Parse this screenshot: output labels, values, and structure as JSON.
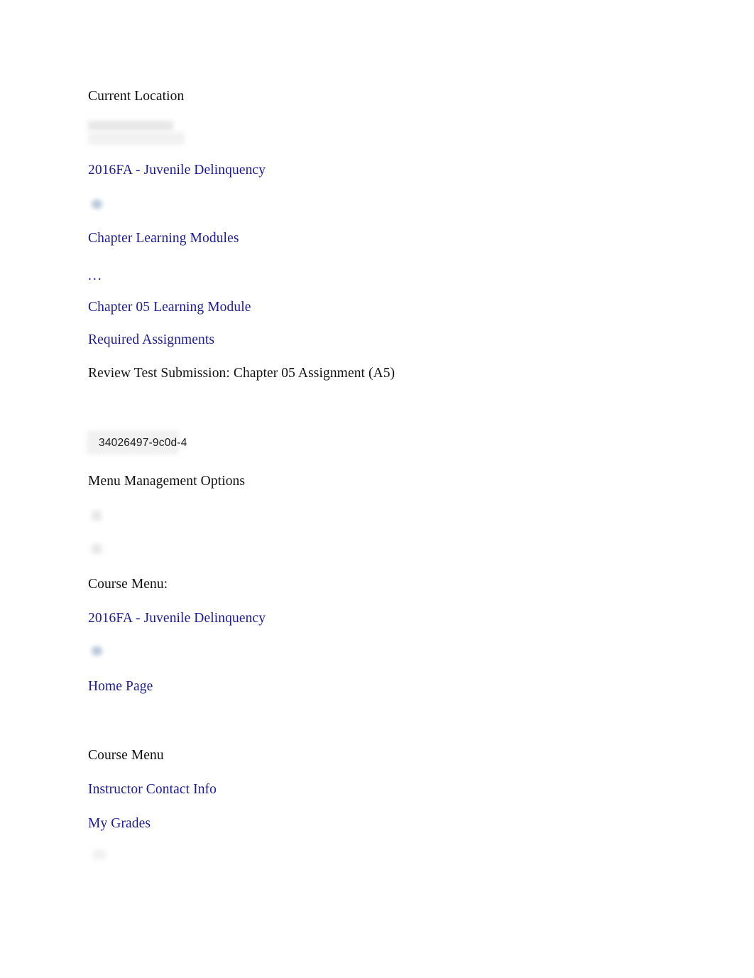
{
  "document": {
    "background_color": "#ffffff",
    "text_color": "#111111",
    "link_color": "#1c1c8f"
  },
  "breadcrumb": {
    "heading": "Current Location",
    "separator": "...",
    "items": [
      {
        "label": "2016FA - Juvenile Delinquency",
        "type": "link"
      },
      {
        "label": "Chapter Learning Modules",
        "type": "link"
      },
      {
        "label": "Chapter 05 Learning Module",
        "type": "link"
      },
      {
        "label": "Required Assignments",
        "type": "link"
      },
      {
        "label": "Review Test Submission: Chapter 05 Assignment (A5)",
        "type": "text"
      }
    ],
    "icons": [
      "institution-logo-placeholder",
      "breadcrumb-separator-icon",
      "breadcrumb-ellipsis-icon"
    ]
  },
  "session": {
    "id_label": "34026497-9c0d-4"
  },
  "menu_management": {
    "heading": "Menu Management Options",
    "icons": [
      "refresh-icon",
      "expand-icon"
    ],
    "course_menu_label": "Course Menu:",
    "course_link": "2016FA - Juvenile Delinquency",
    "course_icon": "course-home-icon",
    "home_page_link": "Home Page"
  },
  "course_menu": {
    "heading": "Course Menu",
    "items": [
      {
        "label": "Instructor Contact Info"
      },
      {
        "label": "My Grades"
      }
    ]
  }
}
